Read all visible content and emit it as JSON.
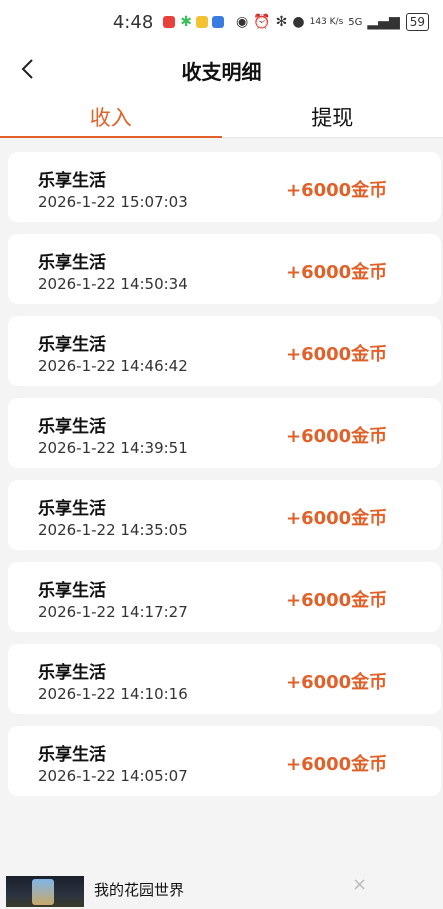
{
  "status_bar": {
    "time": "4:48",
    "net_speed": "143 K/s",
    "signal": "5G",
    "battery": "59"
  },
  "nav": {
    "title": "收支明细"
  },
  "tabs": [
    {
      "label": "收入",
      "active": true
    },
    {
      "label": "提现",
      "active": false
    }
  ],
  "records": [
    {
      "name": "乐享生活",
      "time": "2026-1-22 15:07:03",
      "amount": "+6000金币"
    },
    {
      "name": "乐享生活",
      "time": "2026-1-22 14:50:34",
      "amount": "+6000金币"
    },
    {
      "name": "乐享生活",
      "time": "2026-1-22 14:46:42",
      "amount": "+6000金币"
    },
    {
      "name": "乐享生活",
      "time": "2026-1-22 14:39:51",
      "amount": "+6000金币"
    },
    {
      "name": "乐享生活",
      "time": "2026-1-22 14:35:05",
      "amount": "+6000金币"
    },
    {
      "name": "乐享生活",
      "time": "2026-1-22 14:17:27",
      "amount": "+6000金币"
    },
    {
      "name": "乐享生活",
      "time": "2026-1-22 14:10:16",
      "amount": "+6000金币"
    },
    {
      "name": "乐享生活",
      "time": "2026-1-22 14:05:07",
      "amount": "+6000金币"
    }
  ],
  "ad": {
    "title": "我的花园世界",
    "subtitle": "",
    "close": "×"
  },
  "colors": {
    "accent": "#e0622a",
    "background": "#f4f4f4"
  }
}
